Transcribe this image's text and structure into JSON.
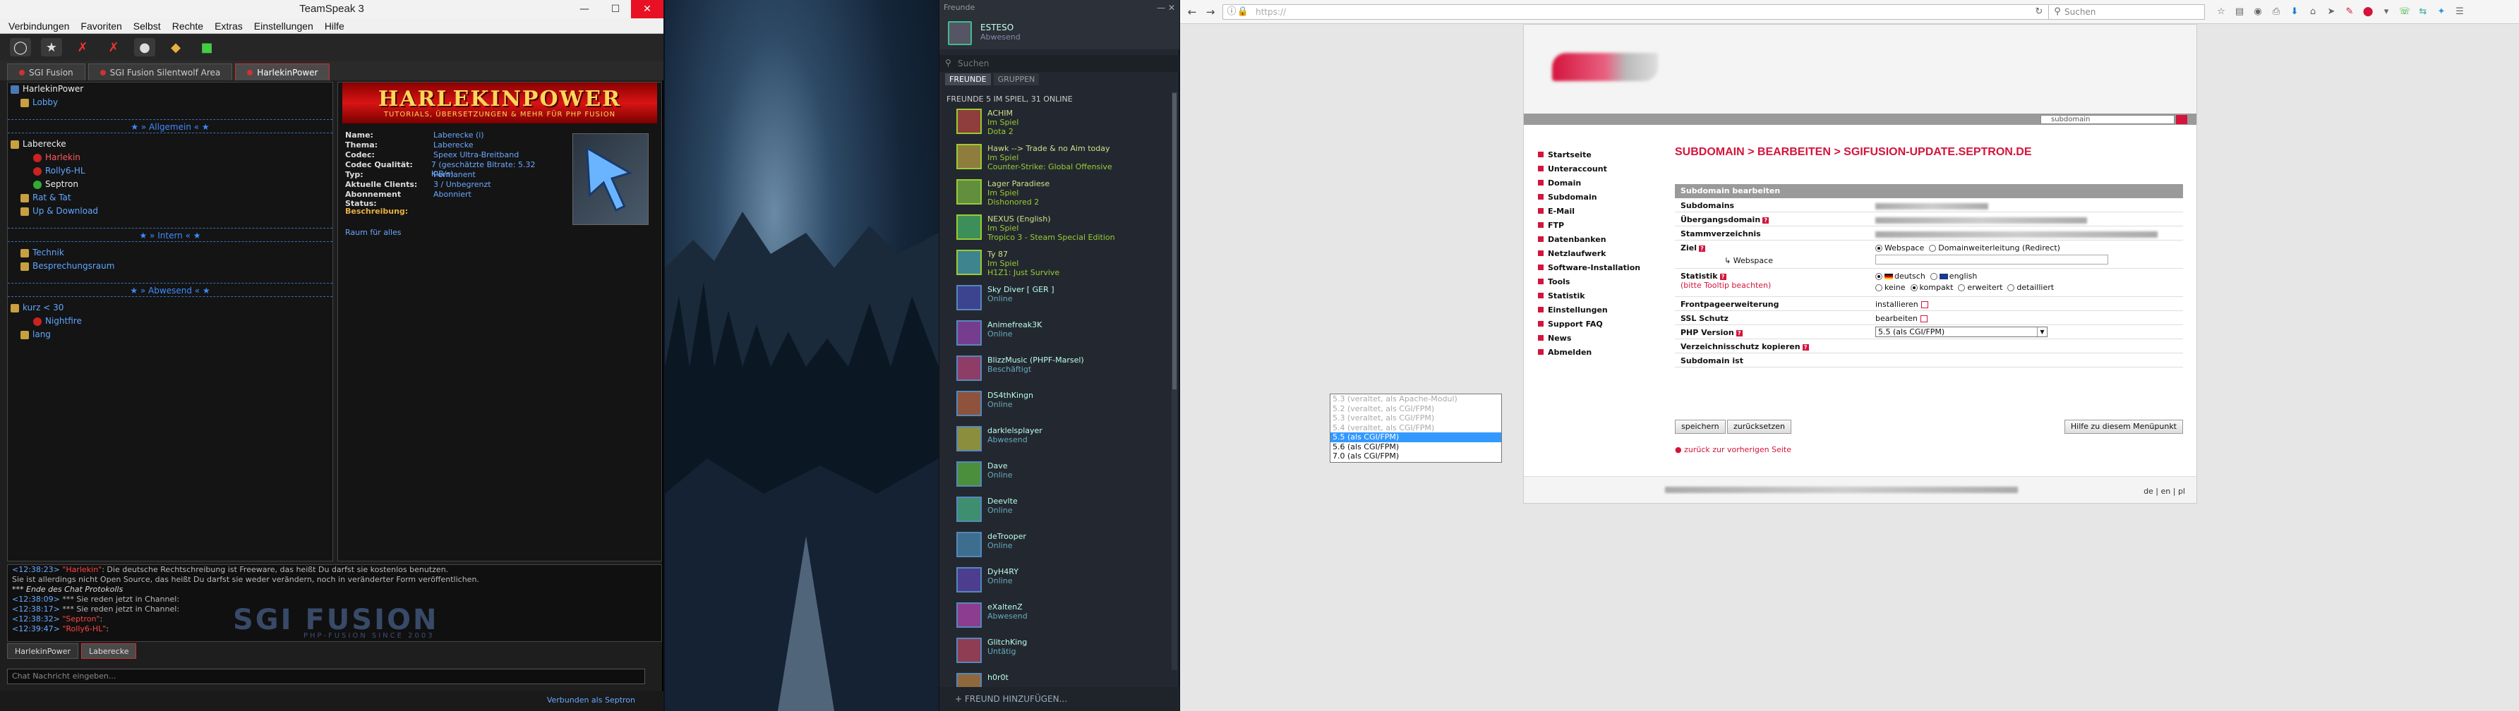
{
  "teamspeak": {
    "title": "TeamSpeak 3",
    "menu": [
      "Verbindungen",
      "Favoriten",
      "Selbst",
      "Rechte",
      "Extras",
      "Einstellungen",
      "Hilfe"
    ],
    "tabs": [
      "SGI Fusion",
      "SGI Fusion Silentwolf Area",
      "HarlekinPower"
    ],
    "tree": {
      "server": "HarlekinPower",
      "lobby": "Lobby",
      "spacer_allgemein": "★ » Allgemein « ★",
      "channel_laberecke": "Laberecke",
      "users_laberecke": [
        "Harlekin",
        "Rolly6-HL",
        "Septron"
      ],
      "channel_rat": "Rat & Tat",
      "channel_up": "Up & Download",
      "spacer_intern": "★ » Intern « ★",
      "channel_technik": "Technik",
      "channel_bespr": "Besprechungsraum",
      "spacer_abwesend": "★ » Abwesend « ★",
      "channel_kurz": "kurz < 30",
      "users_kurz": [
        "Nightfire"
      ],
      "channel_lang": "lang"
    },
    "banner": {
      "logo": "HARLEKINPOWER",
      "sub": "TUTORIALS, ÜBERSETZUNGEN & MEHR FÜR PHP FUSION"
    },
    "info": [
      {
        "k": "Name:",
        "v": "Laberecke (i)"
      },
      {
        "k": "Thema:",
        "v": "Laberecke"
      },
      {
        "k": "Codec:",
        "v": "Speex Ultra-Breitband"
      },
      {
        "k": "Codec Qualität:",
        "v": "7 (geschätzte Bitrate: 5.32 KiB/s)"
      },
      {
        "k": "Typ:",
        "v": "Permanent"
      },
      {
        "k": "Aktuelle Clients:",
        "v": "3 / Unbegrenzt"
      },
      {
        "k": "Abonnement Status:",
        "v": "Abonniert"
      }
    ],
    "beschreibung_label": "Beschreibung:",
    "beschreibung_text": "Raum für alles",
    "chat": [
      {
        "time": "<12:38:23>",
        "name": "\"Harlekin\"",
        "text": ": Die deutsche Rechtschreibung ist Freeware, das heißt Du darfst sie kostenlos benutzen."
      },
      {
        "time": "",
        "name": "",
        "text": "Sie ist allerdings nicht Open Source, das heißt Du darfst sie weder verändern, noch in veränderter Form veröffentlichen."
      },
      {
        "time": "",
        "name": "",
        "text": "*** Ende des Chat Protokolls"
      },
      {
        "time": "<12:38:09>",
        "name": "",
        "text": "*** Sie reden jetzt in Channel: "
      },
      {
        "time": "<12:38:17>",
        "name": "",
        "text": "*** Sie reden jetzt in Channel: "
      },
      {
        "time": "<12:38:32>",
        "name": "\"Septron\"",
        "text": ": "
      },
      {
        "time": "<12:39:47>",
        "name": "\"Rolly6-HL\"",
        "text": ": "
      }
    ],
    "watermark": "SGI FUSION",
    "watermark_sub": "PHP-FUSION SINCE 2003",
    "chat_tabs": [
      "HarlekinPower",
      "Laberecke"
    ],
    "chat_placeholder": "Chat Nachricht eingeben...",
    "status": "Verbunden als Septron"
  },
  "steam": {
    "title": "Freunde",
    "username": "ESTESO",
    "userstatus": "Abwesend",
    "search_placeholder": "Suchen",
    "tab_friends": "FREUNDE",
    "tab_groups": "GRUPPEN",
    "section": "FREUNDE   5 IM SPIEL, 31 ONLINE",
    "friends": [
      {
        "n": "ACHIM",
        "s": "Im Spiel",
        "g": "Dota 2",
        "state": "ingame"
      },
      {
        "n": "Hawk --> Trade & no Aim today",
        "s": "Im Spiel",
        "g": "Counter-Strike: Global Offensive",
        "state": "ingame"
      },
      {
        "n": "Lager Paradiese",
        "s": "Im Spiel",
        "g": "Dishonored 2",
        "state": "ingame"
      },
      {
        "n": "NEXUS (English)",
        "s": "Im Spiel",
        "g": "Tropico 3 - Steam Special Edition",
        "state": "ingame"
      },
      {
        "n": "Ty   87",
        "s": "Im Spiel",
        "g": "H1Z1: Just Survive",
        "state": "ingame"
      },
      {
        "n": "Sky Diver [ GER ]",
        "s": "Online",
        "g": "",
        "state": "online"
      },
      {
        "n": "Animefreak3K",
        "s": "Online",
        "g": "",
        "state": "online"
      },
      {
        "n": "BlizzMusic (PHPF-Marsel)",
        "s": "Beschäftigt",
        "g": "",
        "state": "online"
      },
      {
        "n": "DS4thKingn",
        "s": "Online",
        "g": "",
        "state": "online"
      },
      {
        "n": "darklelsplayer",
        "s": "Abwesend",
        "g": "",
        "state": "online"
      },
      {
        "n": "Dave",
        "s": "Online",
        "g": "",
        "state": "online"
      },
      {
        "n": "Deevlte",
        "s": "Online",
        "g": "",
        "state": "online"
      },
      {
        "n": "deTrooper",
        "s": "Online",
        "g": "",
        "state": "online"
      },
      {
        "n": "DyH4RY",
        "s": "Online",
        "g": "",
        "state": "online"
      },
      {
        "n": "eXaltenZ",
        "s": "Abwesend",
        "g": "",
        "state": "online"
      },
      {
        "n": "GlitchKing",
        "s": "Untätig",
        "g": "",
        "state": "online"
      },
      {
        "n": "h0r0t",
        "s": "",
        "g": "",
        "state": "online"
      }
    ],
    "add_friend": "+ FREUND HINZUFÜGEN..."
  },
  "firefox": {
    "url": "https://",
    "search_placeholder": "Suchen",
    "site_search": "subdomain",
    "nav": [
      "Startseite",
      "Unteraccount",
      "Domain",
      "Subdomain",
      "E-Mail",
      "FTP",
      "Datenbanken",
      "Netzlaufwerk",
      "Software-Installation",
      "Tools",
      "Statistik",
      "Einstellungen",
      "Support FAQ",
      "News",
      "Abmelden"
    ],
    "breadcrumb": "SUBDOMAIN > BEARBEITEN > SGIFUSION-UPDATE.SEPTRON.DE",
    "form_head": "Subdomain bearbeiten",
    "labels": {
      "subdomains": "Subdomains",
      "uebergang": "Übergangsdomain",
      "stamm": "Stammverzeichnis",
      "ziel": "Ziel",
      "webspace": "Webspace",
      "domainweiter": "Domainweiterleitung (Redirect)",
      "webspace_sub": "↳ Webspace",
      "statistik": "Statistik",
      "statistik_hint": "(bitte Tooltip beachten)",
      "deutsch": "deutsch",
      "english": "english",
      "keine": "keine",
      "kompakt": "kompakt",
      "erweitert": "erweitert",
      "detailliert": "detailliert",
      "frontpage": "Frontpageerweiterung",
      "installieren": "installieren",
      "ssl": "SSL Schutz",
      "bearbeiten": "bearbeiten",
      "php": "PHP Version",
      "verz": "Verzeichnisschutz kopieren",
      "subist": "Subdomain ist"
    },
    "php_selected": "5.5 (als CGI/FPM)",
    "php_options": [
      {
        "t": "5.3 (veraltet, als Apache-Modul)",
        "state": "dis"
      },
      {
        "t": "5.2 (veraltet, als CGI/FPM)",
        "state": "dis"
      },
      {
        "t": "5.3 (veraltet, als CGI/FPM)",
        "state": "dis"
      },
      {
        "t": "5.4 (veraltet, als CGI/FPM)",
        "state": "dis"
      },
      {
        "t": "5.5 (als CGI/FPM)",
        "state": "sel"
      },
      {
        "t": "5.6 (als CGI/FPM)",
        "state": ""
      },
      {
        "t": "7.0 (als CGI/FPM)",
        "state": ""
      }
    ],
    "btn_save": "speichern",
    "btn_reset": "zurücksetzen",
    "btn_help": "Hilfe zu diesem Menüpunkt",
    "back": "● zurück zur vorherigen Seite",
    "langs": "de | en | pl"
  }
}
